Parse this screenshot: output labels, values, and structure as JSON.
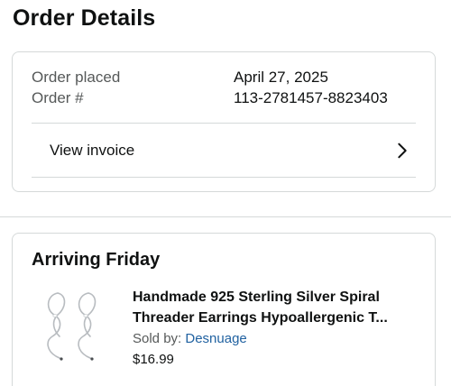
{
  "page": {
    "title": "Order Details"
  },
  "order_info": {
    "placed_label": "Order placed",
    "placed_value": "April 27, 2025",
    "number_label": "Order #",
    "number_value": "113-2781457-8823403",
    "invoice_label": "View invoice"
  },
  "shipment": {
    "status": "Arriving Friday",
    "item": {
      "title": "Handmade 925 Sterling Silver Spiral Threader Earrings Hypoallergenic T...",
      "sold_by_label": "Sold by: ",
      "seller": "Desnuage",
      "price": "$16.99"
    }
  },
  "icons": {
    "chevron": "chevron-right-icon",
    "product": "earrings-product-image"
  },
  "colors": {
    "link": "#2162a1",
    "border": "#d5d9d9",
    "secondary_text": "#565959"
  }
}
